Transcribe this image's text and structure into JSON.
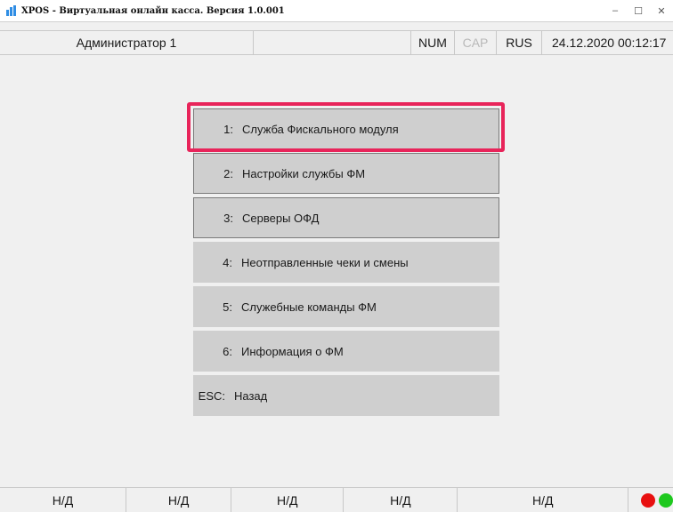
{
  "window": {
    "title": "XPOS - Виртуальная онлайн касса. Версия 1.0.001",
    "icon": "app-icon",
    "controls": {
      "minimize": "–",
      "maximize": "☐",
      "close": "✕"
    }
  },
  "status": {
    "user": "Администратор 1",
    "num": "NUM",
    "cap": "CAP",
    "lang": "RUS",
    "datetime": "24.12.2020 00:12:17"
  },
  "menu": {
    "items": [
      {
        "key": "1:",
        "label": "Служба Фискального модуля"
      },
      {
        "key": "2:",
        "label": "Настройки службы ФМ"
      },
      {
        "key": "3:",
        "label": "Серверы ОФД"
      },
      {
        "key": "4:",
        "label": "Неотправленные чеки и смены"
      },
      {
        "key": "5:",
        "label": "Служебные команды ФМ"
      },
      {
        "key": "6:",
        "label": "Информация о ФМ"
      },
      {
        "key": "ESC:",
        "label": "Назад"
      }
    ],
    "highlight_color": "#e8245a"
  },
  "bottom": {
    "cells": [
      "Н/Д",
      "Н/Д",
      "Н/Д",
      "Н/Д",
      "Н/Д"
    ],
    "indicators": [
      "#e81010",
      "#1ec81e"
    ]
  }
}
